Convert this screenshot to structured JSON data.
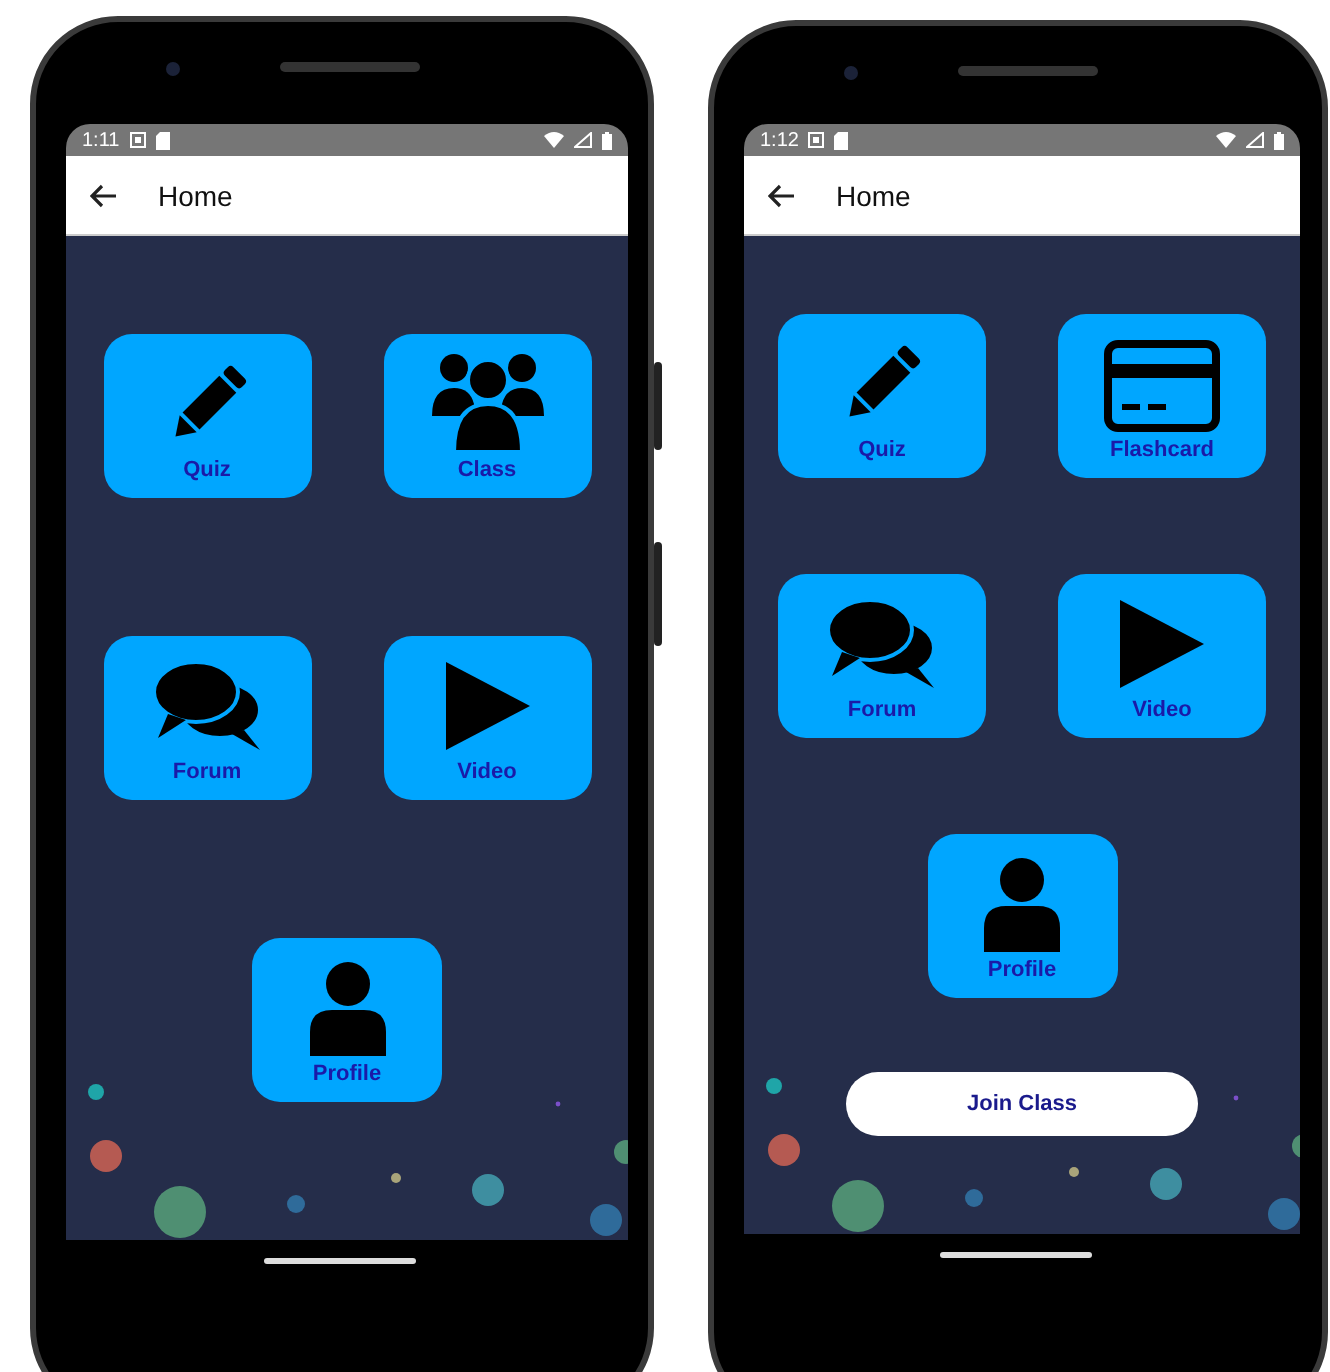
{
  "phones": [
    {
      "status_time": "1:11",
      "title": "Home",
      "tiles": [
        {
          "label": "Quiz",
          "kind": "pencil"
        },
        {
          "label": "Class",
          "kind": "people"
        },
        {
          "label": "Forum",
          "kind": "chat"
        },
        {
          "label": "Video",
          "kind": "play"
        },
        {
          "label": "Profile",
          "kind": "person"
        }
      ]
    },
    {
      "status_time": "1:12",
      "title": "Home",
      "tiles": [
        {
          "label": "Quiz",
          "kind": "pencil"
        },
        {
          "label": "Flashcard",
          "kind": "card"
        },
        {
          "label": "Forum",
          "kind": "chat"
        },
        {
          "label": "Video",
          "kind": "play"
        },
        {
          "label": "Profile",
          "kind": "person"
        }
      ],
      "join_button": "Join Class"
    }
  ]
}
